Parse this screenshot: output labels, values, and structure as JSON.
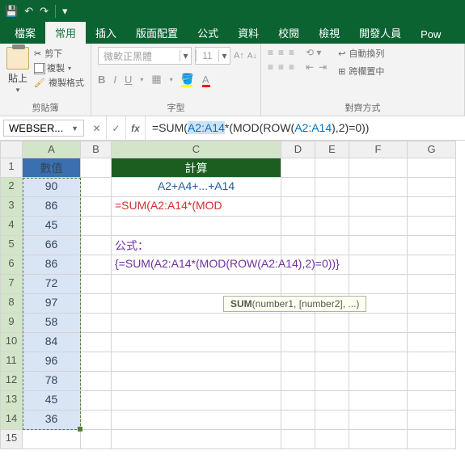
{
  "titlebar": {
    "save": "💾"
  },
  "tabs": [
    "檔案",
    "常用",
    "插入",
    "版面配置",
    "公式",
    "資料",
    "校閱",
    "檢視",
    "開發人員",
    "Pow"
  ],
  "active_tab": 1,
  "ribbon": {
    "clipboard": {
      "paste": "貼上",
      "cut": "剪下",
      "copy": "複製",
      "format_painter": "複製格式",
      "label": "剪貼簿"
    },
    "font": {
      "family": "微軟正黑體",
      "size": "11",
      "bold": "B",
      "italic": "I",
      "underline": "U",
      "label": "字型"
    },
    "align": {
      "wrap": "自動換列",
      "merge": "跨欄置中",
      "label": "對齊方式"
    }
  },
  "formula_bar": {
    "namebox": "WEBSER...",
    "formula_prefix": "=SUM(",
    "formula_ref1": "A2:A14",
    "formula_mid": "*(MOD(ROW(",
    "formula_ref2": "A2:A14",
    "formula_suffix": "),2)=0))"
  },
  "tooltip": {
    "fn": "SUM",
    "args": "(number1, [number2], ...)"
  },
  "columns": [
    "A",
    "B",
    "C",
    "D",
    "E",
    "F",
    "G"
  ],
  "rows": [
    "1",
    "2",
    "3",
    "4",
    "5",
    "6",
    "7",
    "8",
    "9",
    "10",
    "11",
    "12",
    "13",
    "14",
    "15"
  ],
  "header_A": "數值",
  "header_C": "計算",
  "colA_values": [
    "90",
    "86",
    "45",
    "66",
    "86",
    "72",
    "97",
    "58",
    "84",
    "96",
    "78",
    "45",
    "36"
  ],
  "c2": "A2+A4+...+A14",
  "c3": "=SUM(A2:A14*(MOD",
  "c5": "公式：",
  "c6": "{=SUM(A2:A14*(MOD(ROW(A2:A14),2)=0))}"
}
